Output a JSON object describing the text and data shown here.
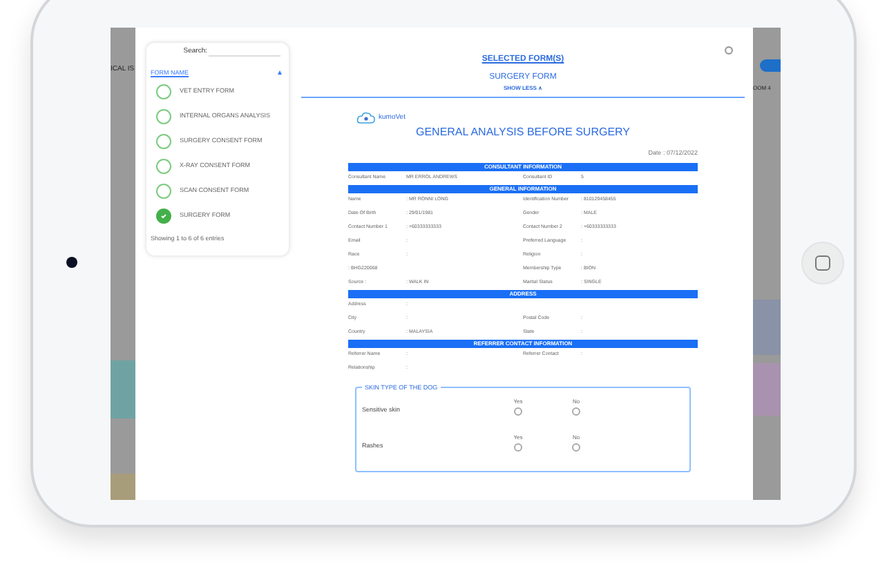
{
  "background_app": {
    "left_text": "ICAL IS",
    "right_text": "OOM 4"
  },
  "form_picker": {
    "search_label": "Search:",
    "column_header": "FORM NAME",
    "forms": [
      {
        "name": "VET ENTRY FORM",
        "selected": false
      },
      {
        "name": "INTERNAL ORGANS ANALYSIS",
        "selected": false
      },
      {
        "name": "SURGERY CONSENT FORM",
        "selected": false
      },
      {
        "name": "X-RAY CONSENT FORM",
        "selected": false
      },
      {
        "name": "SCAN CONSENT FORM",
        "selected": false
      },
      {
        "name": "SURGERY FORM",
        "selected": true
      }
    ],
    "footer": "Showing 1 to 6 of 6 entries"
  },
  "header": {
    "title": "SELECTED FORM(S)",
    "form_name": "SURGERY FORM",
    "toggle": "SHOW LESS ∧"
  },
  "document": {
    "logo_text": "kumoVet",
    "title": "GENERAL ANALYSIS BEFORE SURGERY",
    "date": "Date : 07/12/2022",
    "sections": [
      {
        "heading": "CONSULTANT INFORMATION",
        "rows": [
          [
            {
              "label": "Consultant Name",
              "value": "MR ERROL ANDREWS"
            },
            {
              "label": "Consultant ID",
              "value": "5"
            }
          ]
        ]
      },
      {
        "heading": "GENERAL INFORMATION",
        "rows": [
          [
            {
              "label": "Name",
              "value": ": MR RONNI LONG"
            },
            {
              "label": "Identification Number",
              "value": ": 810129458455"
            }
          ],
          [
            {
              "label": "Date Of Birth",
              "value": ": 29/01/1981"
            },
            {
              "label": "Gender",
              "value": ": MALE"
            }
          ],
          [
            {
              "label": "Contact Number 1",
              "value": ": +60333333333"
            },
            {
              "label": "Contact Number 2",
              "value": ": +60333333333"
            }
          ],
          [
            {
              "label": "Email",
              "value": ":"
            },
            {
              "label": "Preferred Language",
              "value": ":"
            }
          ],
          [
            {
              "label": "Race",
              "value": ":"
            },
            {
              "label": "Religion",
              "value": ":"
            }
          ],
          [
            {
              "label": ": BHG220068"
            },
            {
              "label": "Membership Type",
              "value": ": BION"
            }
          ],
          [
            {
              "label": "Source :",
              "value": ": WALK IN"
            },
            {
              "label": "Marital Status",
              "value": ": SINGLE"
            }
          ]
        ]
      },
      {
        "heading": "ADDRESS",
        "rows": [
          [
            {
              "label": "Address",
              "value": ":"
            }
          ],
          [
            {
              "label": "City",
              "value": ":"
            },
            {
              "label": "Postal Code",
              "value": ":"
            }
          ],
          [
            {
              "label": "Country",
              "value": ": MALAYSIA"
            },
            {
              "label": "State",
              "value": ":"
            }
          ]
        ]
      },
      {
        "heading": "REFERRER CONTACT INFORMATION",
        "rows": [
          [
            {
              "label": "Referrer Name",
              "value": ":"
            },
            {
              "label": "Referrer Contact",
              "value": ":"
            }
          ],
          [
            {
              "label": "Relationship",
              "value": ":"
            }
          ]
        ]
      }
    ],
    "skin_type": {
      "legend": "SKIN TYPE OF THE DOG",
      "questions": [
        {
          "label": "Sensitive skin",
          "options": [
            {
              "label": "Yes",
              "selected": false
            },
            {
              "label": "No",
              "selected": false
            }
          ]
        },
        {
          "label": "Rashes",
          "options": [
            {
              "label": "Yes",
              "selected": false
            },
            {
              "label": "No",
              "selected": false
            }
          ]
        }
      ]
    }
  }
}
